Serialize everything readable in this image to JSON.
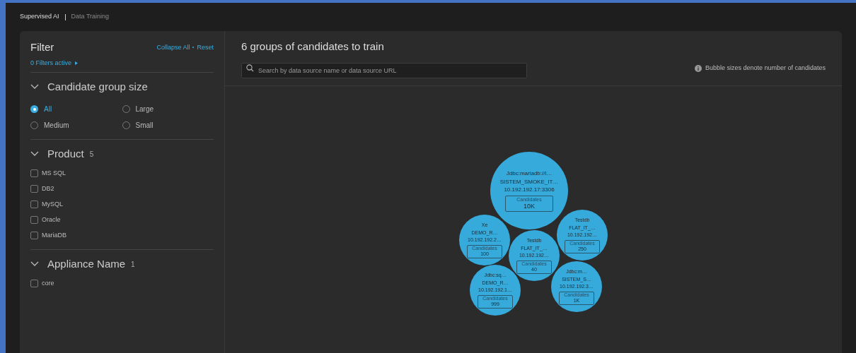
{
  "breadcrumb": [
    {
      "label": "Supervised AI",
      "selected": true
    },
    {
      "label": "Data Training",
      "selected": false
    }
  ],
  "filter": {
    "title": "Filter",
    "collapse_all": "Collapse All",
    "reset": "Reset",
    "active": "0 Filters active",
    "sections": [
      {
        "kind": "radio",
        "title": "Candidate group size",
        "expanded": true,
        "options": [
          {
            "label": "All",
            "selected": true
          },
          {
            "label": "Large",
            "selected": false
          },
          {
            "label": "Medium",
            "selected": false
          },
          {
            "label": "Small",
            "selected": false
          }
        ]
      },
      {
        "kind": "checkbox",
        "title": "Product",
        "count": "5",
        "expanded": true,
        "options": [
          {
            "label": "MS SQL",
            "checked": false
          },
          {
            "label": "DB2",
            "checked": false
          },
          {
            "label": "MySQL",
            "checked": false
          },
          {
            "label": "Oracle",
            "checked": false
          },
          {
            "label": "MariaDB",
            "checked": false
          }
        ]
      },
      {
        "kind": "checkbox",
        "title": "Appliance Name",
        "count": "1",
        "expanded": true,
        "options": [
          {
            "label": "core",
            "checked": false
          }
        ]
      }
    ]
  },
  "main": {
    "title": "6 groups of candidates to train",
    "search": {
      "placeholder": "Search by data source name or data source URL"
    },
    "hint": "Bubble sizes denote number of candidates",
    "bubbles": [
      {
        "lines": [
          "Jdbc:mariadb://l…",
          "SISTEM_SMOKE_IT…",
          "10.192.192.17:3306"
        ],
        "label": "Candidates",
        "count": "10K"
      },
      {
        "lines": [
          "Xe",
          "DEMO_R…",
          "10.192.192.2…"
        ],
        "label": "Candidates",
        "count": "100"
      },
      {
        "lines": [
          "Testdb",
          "FLAT_IT_…",
          "10.192.192…"
        ],
        "label": "Candidates",
        "count": "40"
      },
      {
        "lines": [
          "Testdb",
          "FLAT_IT_…",
          "10.192.192…"
        ],
        "label": "Candidates",
        "count": "250"
      },
      {
        "lines": [
          "Jdbc:sq…",
          "DEMO_R…",
          "10.192.192.1…"
        ],
        "label": "Candidates",
        "count": "999"
      },
      {
        "lines": [
          "Jdbc:m…",
          "SISTEM_S…",
          "10.192.192.3…"
        ],
        "label": "Candidates",
        "count": "1K"
      }
    ]
  }
}
